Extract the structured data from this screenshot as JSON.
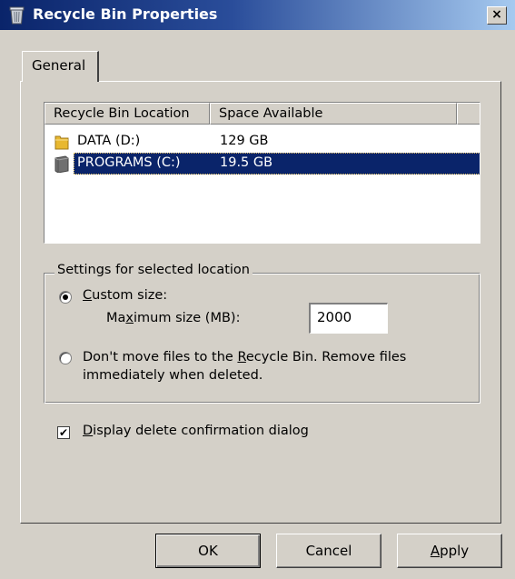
{
  "window": {
    "title": "Recycle Bin Properties",
    "close_label": "×"
  },
  "tabs": [
    {
      "label": "General",
      "selected": true
    }
  ],
  "list": {
    "columns": [
      "Recycle Bin Location",
      "Space Available"
    ],
    "rows": [
      {
        "location": "DATA (D:)",
        "space": "129 GB",
        "icon": "folder-icon",
        "selected": false
      },
      {
        "location": "PROGRAMS (C:)",
        "space": "19.5 GB",
        "icon": "drive-icon",
        "selected": true
      }
    ]
  },
  "settings": {
    "legend": "Settings for selected location",
    "custom_size_prefix": "",
    "custom_size_underline": "C",
    "custom_size_rest": "ustom size:",
    "max_size_pre": "Ma",
    "max_size_underline": "x",
    "max_size_rest": "imum size (MB):",
    "max_size_value": "2000",
    "dont_move_pre": "Don't move files to the ",
    "dont_move_underline": "R",
    "dont_move_rest": "ecycle Bin. Remove files",
    "dont_move_line2": "immediately when deleted.",
    "selected_option": "custom"
  },
  "confirm": {
    "underline": "D",
    "rest": "isplay delete confirmation dialog",
    "checked": true
  },
  "buttons": {
    "ok": "OK",
    "cancel": "Cancel",
    "apply_underline": "A",
    "apply_rest": "pply"
  },
  "colors": {
    "title_bar": "#0a246a",
    "selection": "#0a246a",
    "dialog_face": "#d4d0c8"
  }
}
